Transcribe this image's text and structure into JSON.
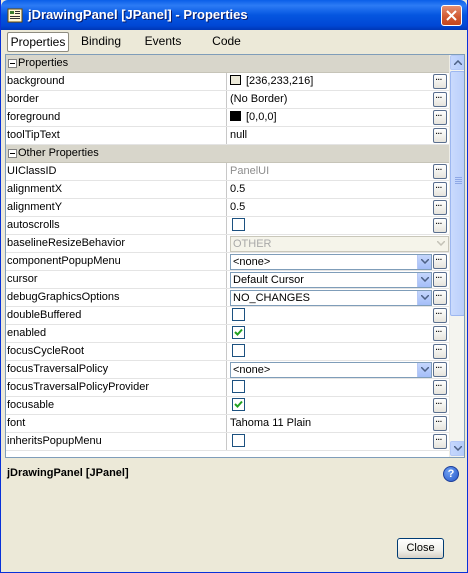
{
  "window": {
    "title": "jDrawingPanel [JPanel] - Properties"
  },
  "tabs": [
    {
      "label": "Properties",
      "active": true
    },
    {
      "label": "Binding",
      "active": false
    },
    {
      "label": "Events",
      "active": false
    },
    {
      "label": "Code",
      "active": false
    }
  ],
  "categories": {
    "properties": "Properties",
    "other": "Other Properties"
  },
  "properties": [
    {
      "name": "background",
      "value": "[236,233,216]",
      "swatch": "#ECE9D8"
    },
    {
      "name": "border",
      "value": "(No Border)"
    },
    {
      "name": "foreground",
      "value": "[0,0,0]",
      "swatch": "#000000"
    },
    {
      "name": "toolTipText",
      "value": "null"
    }
  ],
  "other_properties": [
    {
      "name": "UIClassID",
      "value": "PanelUI",
      "disabled": true
    },
    {
      "name": "alignmentX",
      "value": "0.5"
    },
    {
      "name": "alignmentY",
      "value": "0.5"
    },
    {
      "name": "autoscrolls",
      "checked": false
    },
    {
      "name": "baselineResizeBehavior",
      "value": "OTHER",
      "disabled": true
    },
    {
      "name": "componentPopupMenu",
      "value": "<none>"
    },
    {
      "name": "cursor",
      "value": "Default Cursor"
    },
    {
      "name": "debugGraphicsOptions",
      "value": "NO_CHANGES"
    },
    {
      "name": "doubleBuffered",
      "checked": false
    },
    {
      "name": "enabled",
      "checked": true
    },
    {
      "name": "focusCycleRoot",
      "checked": false
    },
    {
      "name": "focusTraversalPolicy",
      "value": "<none>"
    },
    {
      "name": "focusTraversalPolicyProvider",
      "checked": false
    },
    {
      "name": "focusable",
      "checked": true
    },
    {
      "name": "font",
      "value": "Tahoma 11 Plain"
    },
    {
      "name": "inheritsPopupMenu",
      "checked": false
    }
  ],
  "ellipsis_label": "...",
  "description": {
    "title": "jDrawingPanel [JPanel]"
  },
  "buttons": {
    "close": "Close"
  },
  "colors": {
    "title_bar": "#0556E0",
    "dialog_bg": "#ECE9D8",
    "category_bg": "#D8D6CB"
  },
  "icons": [
    "app-icon",
    "window-close-icon",
    "collapse-icon",
    "ellipsis-icon",
    "dropdown-arrow-icon",
    "checkbox-check-icon",
    "scroll-up-icon",
    "scroll-down-icon",
    "help-icon"
  ]
}
